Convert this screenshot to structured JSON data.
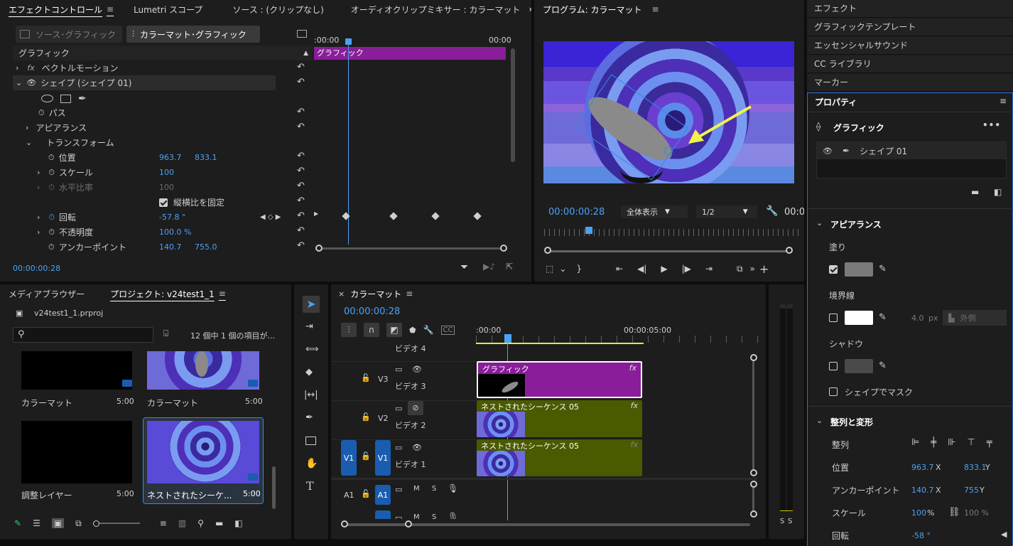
{
  "effect_controls": {
    "tabs": [
      {
        "label": "エフェクトコントロール",
        "active": true
      },
      {
        "label": "Lumetri スコープ"
      },
      {
        "label": "ソース : (クリップなし)"
      },
      {
        "label": "オーディオクリップミキサー : カラーマット"
      }
    ],
    "overflow_icon": "»",
    "source_graphic_btn": "ソース･グラフィック",
    "colormatte_graphic_btn": "カラーマット･グラフィック",
    "section_label": "グラフィック",
    "props": {
      "vector_motion": "ベクトルモーション",
      "shape": "シェイプ (シェイプ 01)",
      "path": "パス",
      "appearance": "アピアランス",
      "transform": "トランスフォーム",
      "position": "位置",
      "position_x": "963.7",
      "position_y": "833.1",
      "scale": "スケール",
      "scale_val": "100",
      "h_ratio": "水平比率",
      "h_ratio_val": "100",
      "lock_aspect": "縦横比を固定",
      "rotation": "回転",
      "rotation_val": "-57.8 °",
      "opacity": "不透明度",
      "opacity_val": "100.0 %",
      "anchor": "アンカーポイント",
      "anchor_x": "140.7",
      "anchor_y": "755.0"
    },
    "timeline_start": ":00:00",
    "timeline_end": "00:00",
    "clip_label": "グラフィック",
    "timecode": "00:00:00:28"
  },
  "program": {
    "tab": "プログラム: カラーマット",
    "timecode": "00:00:00:28",
    "zoom": "全体表示",
    "resolution": "1/2",
    "duration_partial": "00:0"
  },
  "right_panel": {
    "items": [
      "エフェクト",
      "グラフィックテンプレート",
      "エッセンシャルサウンド",
      "CC ライブラリ",
      "マーカー"
    ],
    "properties_tab": "プロパティ",
    "graphic_title": "グラフィック",
    "layer_name": "シェイプ 01",
    "appearance_title": "アピアランス",
    "fill_label": "塗り",
    "stroke_label": "境界線",
    "stroke_width": "4.0",
    "stroke_unit": "px",
    "stroke_position": "外側",
    "shadow_label": "シャドウ",
    "mask_label": "シェイプでマスク",
    "align_title": "整列と変形",
    "align_label": "整列",
    "position_label": "位置",
    "position_x": "963.7",
    "position_y": "833.1",
    "anchor_label": "アンカーポイント",
    "anchor_x": "140.7",
    "anchor_y": "755",
    "scale_label": "スケール",
    "scale_val": "100",
    "scale_unit": "%",
    "scale_linked": "100 %",
    "rotation_label": "回転",
    "rotation_val": "-58 °",
    "x_tag": "X",
    "y_tag": "Y",
    "colors": {
      "fill": "#7a7a7a",
      "stroke": "#ffffff",
      "shadow": "#4a4a4a"
    }
  },
  "project": {
    "tabs": [
      {
        "label": "メディアブラウザー"
      },
      {
        "label": "プロジェクト: v24test1_1",
        "active": true
      }
    ],
    "file_name": "v24test1_1.prproj",
    "search_placeholder": "",
    "item_count": "12 個中 1 個の項目が...",
    "items": [
      {
        "name": "カラーマット",
        "duration": "5:00"
      },
      {
        "name": "カラーマット",
        "duration": "5:00"
      },
      {
        "name": "調整レイヤー",
        "duration": "5:00"
      },
      {
        "name": "ネストされたシーケ...",
        "duration": "5:00"
      }
    ]
  },
  "sequence": {
    "tab": "カラーマット",
    "timecode": "00:00:00:28",
    "ruler_start": ":00:00",
    "ruler_mark": "00:00:05:00",
    "tracks": {
      "v4": "ビデオ 4",
      "v3_label": "V3",
      "v3_name": "ビデオ 3",
      "v2_label": "V2",
      "v2_name": "ビデオ 2",
      "v1_label": "V1",
      "v1_name": "ビデオ 1",
      "v1_src": "V1",
      "a1_label": "A1",
      "a1_src": "A1",
      "m": "M",
      "s": "S"
    },
    "clips": {
      "graphic": "グラフィック",
      "nested1": "ネストされたシーケンス 05",
      "nested2": "ネストされたシーケンス 05",
      "fx": "fx"
    },
    "meter_labels": [
      "S",
      "S"
    ]
  }
}
